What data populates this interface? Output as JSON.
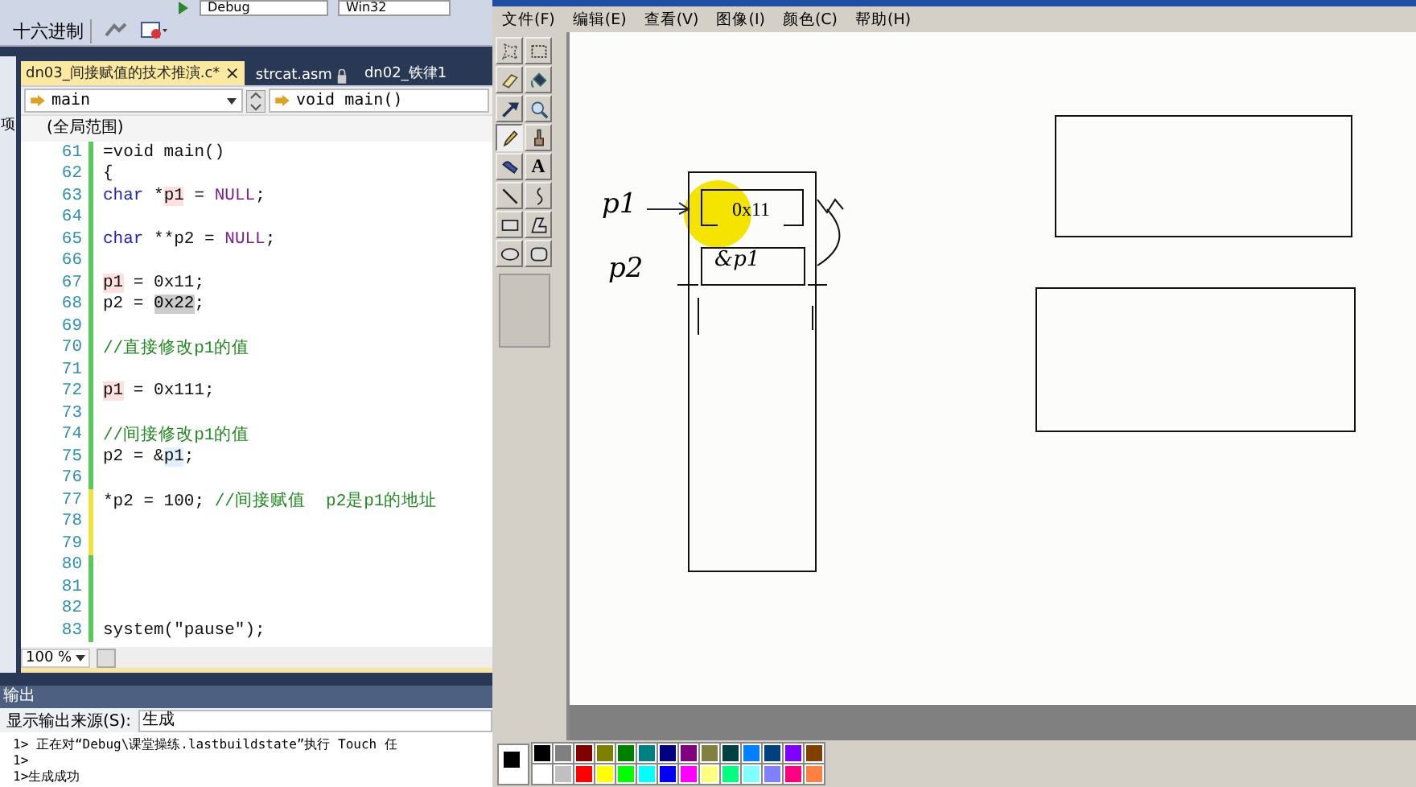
{
  "vs": {
    "toolbar": {
      "config": "Debug",
      "platform": "Win32",
      "hex_button": "十六进制"
    },
    "side_label": "项",
    "tabs": [
      {
        "label": "dn03_间接赋值的技术推演.c*",
        "selected": true,
        "kind": "closable",
        "close": "×"
      },
      {
        "label": "strcat.asm",
        "selected": false,
        "kind": "locked"
      },
      {
        "label": "dn02_铁律1",
        "selected": false,
        "kind": "plain"
      }
    ],
    "nav": {
      "scope_left": "main",
      "scope_right": "void main()",
      "global": "(全局范围)"
    },
    "code": {
      "signature": {
        "num": "61",
        "saved": true,
        "tokens": [
          {
            "kind": "plain",
            "text": "=void main()"
          }
        ]
      },
      "open_brace": {
        "num": "62",
        "saved": true,
        "tokens": [
          {
            "kind": "plain",
            "text": "{"
          }
        ]
      },
      "body": [
        {
          "num": "63",
          "saved": true,
          "tokens": [
            {
              "kind": "keyword",
              "text": "char"
            },
            {
              "kind": "plain",
              "text": " *"
            },
            {
              "kind": "ref",
              "text": "p1"
            },
            {
              "kind": "plain",
              "text": " = "
            },
            {
              "kind": "macro",
              "text": "NULL"
            },
            {
              "kind": "plain",
              "text": ";"
            }
          ]
        },
        {
          "num": "64",
          "saved": true
        },
        {
          "num": "65",
          "saved": true,
          "tokens": [
            {
              "kind": "keyword",
              "text": "char"
            },
            {
              "kind": "plain",
              "text": " **p2 = "
            },
            {
              "kind": "macro",
              "text": "NULL"
            },
            {
              "kind": "plain",
              "text": ";"
            }
          ]
        },
        {
          "num": "66",
          "saved": true
        },
        {
          "num": "67",
          "saved": true,
          "tokens": [
            {
              "kind": "ref",
              "text": "p1"
            },
            {
              "kind": "plain",
              "text": " = 0x11;"
            }
          ]
        },
        {
          "num": "68",
          "saved": true,
          "tokens": [
            {
              "kind": "plain",
              "text": "p2 = "
            },
            {
              "kind": "selection",
              "text": "0x22"
            },
            {
              "kind": "plain",
              "text": ";"
            }
          ]
        },
        {
          "num": "69",
          "saved": true
        },
        {
          "num": "70",
          "saved": true,
          "tokens": [
            {
              "kind": "comment",
              "text": "//直接修改p1的值"
            }
          ]
        },
        {
          "num": "71",
          "saved": true
        },
        {
          "num": "72",
          "saved": true,
          "tokens": [
            {
              "kind": "ref",
              "text": "p1"
            },
            {
              "kind": "plain",
              "text": " = 0x111;"
            }
          ]
        },
        {
          "num": "73",
          "saved": true
        },
        {
          "num": "74",
          "saved": true,
          "tokens": [
            {
              "kind": "comment",
              "text": "//间接修改p1的值"
            }
          ]
        },
        {
          "num": "75",
          "saved": true,
          "tokens": [
            {
              "kind": "plain",
              "text": "p2 = &"
            },
            {
              "kind": "ref2",
              "text": "p1"
            },
            {
              "kind": "plain",
              "text": ";"
            }
          ]
        },
        {
          "num": "76",
          "saved": true
        },
        {
          "num": "77",
          "saved": false,
          "tokens": [
            {
              "kind": "plain",
              "text": "*p2 = 100; "
            },
            {
              "kind": "comment",
              "text": "//间接赋值  p2是p1的地址"
            }
          ]
        },
        {
          "num": "78",
          "saved": false
        },
        {
          "num": "79",
          "saved": false
        },
        {
          "num": "80",
          "saved": true
        },
        {
          "num": "81",
          "saved": true
        },
        {
          "num": "82",
          "saved": true
        },
        {
          "num": "83",
          "saved": true,
          "tokens": [
            {
              "kind": "plain",
              "text": "system(\"pause\");"
            }
          ]
        }
      ]
    },
    "zoom": "100 %",
    "output": {
      "title": "输出",
      "source_label": "显示输出来源(S):",
      "source_value": "生成",
      "lines": [
        "1>  正在对“Debug\\课堂操练.lastbuildstate”执行 Touch 任",
        "1>",
        "1>生成成功"
      ]
    }
  },
  "paint": {
    "menu": [
      "文件(F)",
      "编辑(E)",
      "查看(V)",
      "图像(I)",
      "颜色(C)",
      "帮助(H)"
    ],
    "tools": [
      {
        "kind": "freeselect",
        "selected": false
      },
      {
        "kind": "rectselect",
        "selected": false
      },
      {
        "kind": "eraser",
        "selected": false
      },
      {
        "kind": "fill",
        "selected": false
      },
      {
        "kind": "picker",
        "selected": false
      },
      {
        "kind": "magnifier",
        "selected": false
      },
      {
        "kind": "pencil",
        "selected": true
      },
      {
        "kind": "brush",
        "selected": false
      },
      {
        "kind": "airbrush",
        "selected": false
      },
      {
        "kind": "text",
        "selected": false,
        "label": "A"
      },
      {
        "kind": "line",
        "selected": false
      },
      {
        "kind": "curve",
        "selected": false
      },
      {
        "kind": "rectangle",
        "selected": false
      },
      {
        "kind": "polygon",
        "selected": false
      },
      {
        "kind": "ellipse",
        "selected": false
      },
      {
        "kind": "roundrect",
        "selected": false
      }
    ],
    "canvas": {
      "typed_text": "0x11",
      "handwriting": [
        "p1",
        "p2",
        "&p1"
      ]
    },
    "palette": [
      {
        "color": "#000000"
      },
      {
        "color": "#808080"
      },
      {
        "color": "#800000"
      },
      {
        "color": "#808000"
      },
      {
        "color": "#008000"
      },
      {
        "color": "#008080"
      },
      {
        "color": "#000080"
      },
      {
        "color": "#800080"
      },
      {
        "color": "#808040"
      },
      {
        "color": "#004040"
      },
      {
        "color": "#0080ff"
      },
      {
        "color": "#004080"
      },
      {
        "color": "#8000ff"
      },
      {
        "color": "#804000"
      },
      {
        "color": "#ffffff"
      },
      {
        "color": "#c0c0c0"
      },
      {
        "color": "#ff0000"
      },
      {
        "color": "#ffff00"
      },
      {
        "color": "#00ff00"
      },
      {
        "color": "#00ffff"
      },
      {
        "color": "#0000ff"
      },
      {
        "color": "#ff00ff"
      },
      {
        "color": "#ffff80"
      },
      {
        "color": "#00ff80"
      },
      {
        "color": "#80ffff"
      },
      {
        "color": "#8080ff"
      },
      {
        "color": "#ff0080"
      },
      {
        "color": "#ff8040"
      }
    ]
  }
}
